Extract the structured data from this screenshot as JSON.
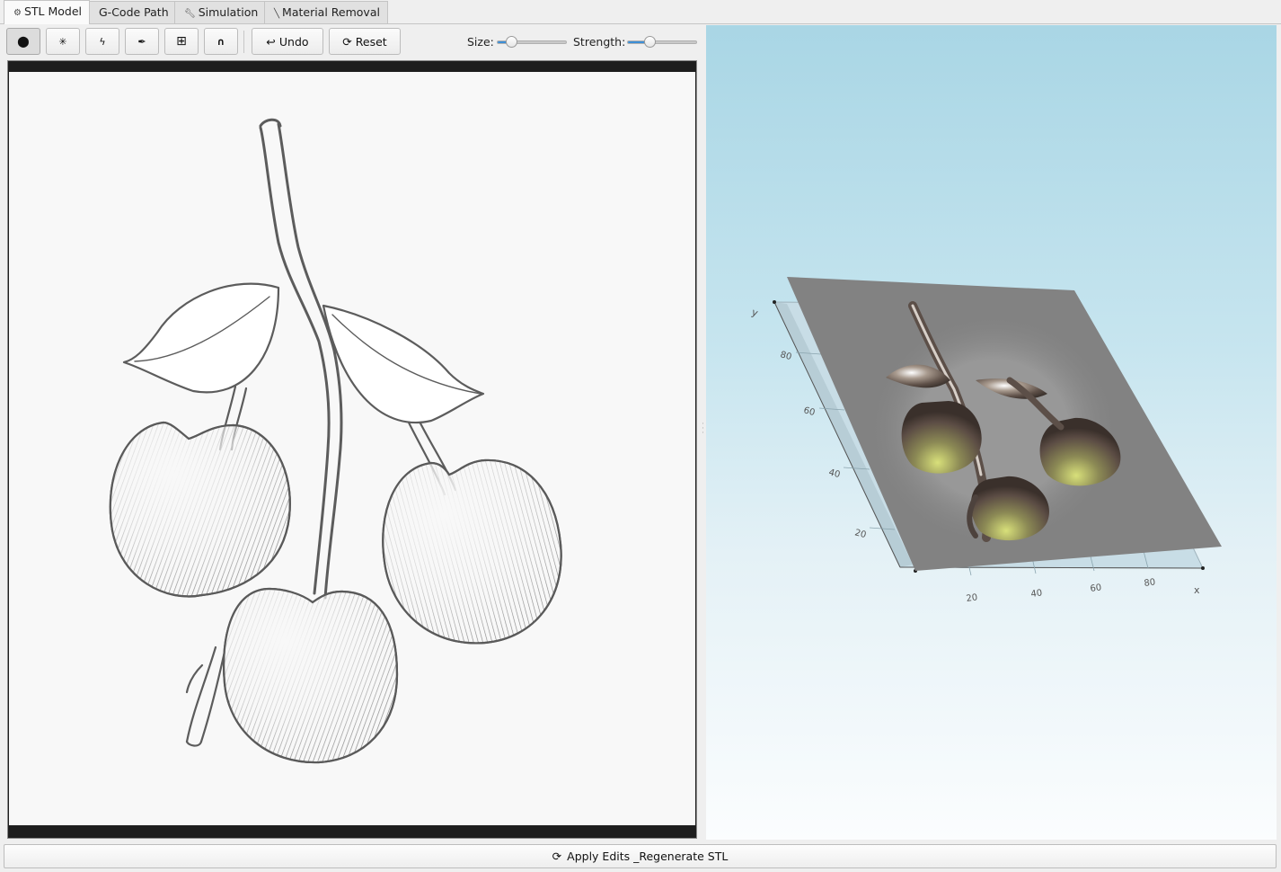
{
  "tabs": [
    {
      "label": "STL Model",
      "icon": "cube-icon",
      "active": true
    },
    {
      "label": "G-Code Path",
      "icon": "",
      "active": false
    },
    {
      "label": "Simulation",
      "icon": "wrench-icon",
      "active": false
    },
    {
      "label": "Material Removal",
      "icon": "knife-icon",
      "active": false
    }
  ],
  "toolbar": {
    "tools": [
      {
        "name": "raise-brush",
        "glyph": "⬤",
        "checked": true
      },
      {
        "name": "smooth-brush",
        "glyph": "✳",
        "checked": false
      },
      {
        "name": "sculpt-brush",
        "glyph": "ϟ",
        "checked": false
      },
      {
        "name": "pen-tool",
        "glyph": "✒",
        "checked": false
      },
      {
        "name": "grid-tool",
        "glyph": "⊞",
        "checked": false
      },
      {
        "name": "magnet-tool",
        "glyph": "∩",
        "checked": false
      }
    ],
    "undo": {
      "glyph": "↩",
      "label": "Undo"
    },
    "reset": {
      "glyph": "⟳",
      "label": "Reset"
    },
    "size_label": "Size:",
    "size_value": 0.2,
    "strength_label": "Strength:",
    "strength_value": 0.32
  },
  "viewer": {
    "axis_x_label": "x",
    "axis_y_label": "y",
    "x_ticks": [
      "20",
      "40",
      "60",
      "80"
    ],
    "y_ticks": [
      "20",
      "40",
      "60",
      "80"
    ],
    "plane_color": "#828282",
    "background_top": "#a9d6e5",
    "background_bottom": "#fbfdfe"
  },
  "apply": {
    "glyph": "⟳",
    "label": "Apply Edits _Regenerate STL"
  }
}
